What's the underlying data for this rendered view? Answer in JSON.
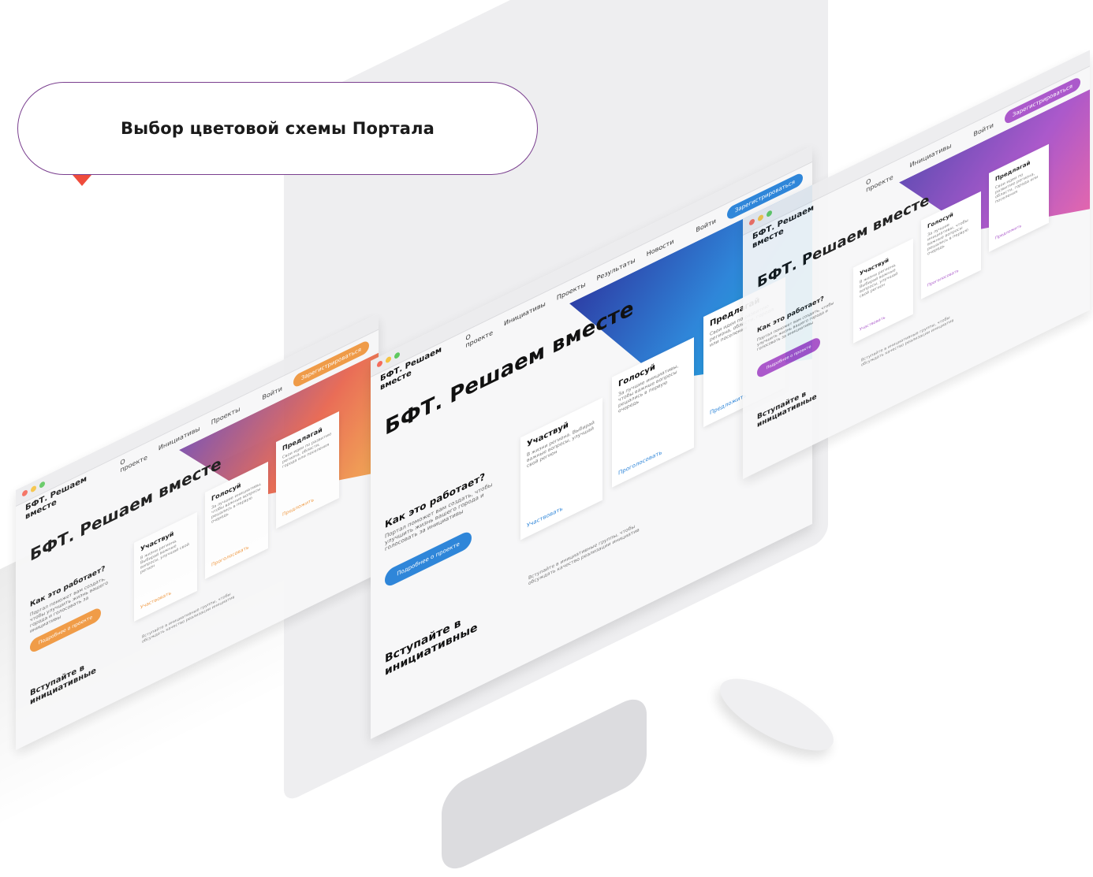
{
  "bubble": {
    "title": "Выбор цветовой схемы Портала"
  },
  "colors": {
    "bubble_border": "#7a3f8f",
    "bubble_tail": "#ef4c3c",
    "orange": "#f0953a",
    "blue": "#2f86d9",
    "purple": "#a44bc7"
  },
  "portal": {
    "logo": "БФТ. Решаем вместе",
    "nav": [
      "О проекте",
      "Инициативы",
      "Проекты",
      "Результаты",
      "Новости"
    ],
    "login": "Войти",
    "register": "Зарегистрироваться",
    "headline": "БФТ. Решаем вместе",
    "how_title": "Как это работает?",
    "how_text": "Портал поможет вам создать, чтобы улучшить жизнь вашего города и голосовать за инициативы",
    "more_button": "Подробнее о проекте",
    "cards": [
      {
        "title": "Участвуй",
        "desc": "В жизни региона. Выбирай важные вопросы, улучшай свой регион",
        "link": "Участвовать"
      },
      {
        "title": "Голосуй",
        "desc": "За лучшие инициативы, чтобы важные вопросы решались в первую очередь",
        "link": "Проголосовать"
      },
      {
        "title": "Предлагай",
        "desc": "Свои идеи по развитию региона, области, города или поселения",
        "link": "Предложить"
      }
    ],
    "join_title": "Вступайте в инициативные",
    "join_text": "Вступайте в инициативные группы, чтобы обсуждать качество реализации инициатив"
  }
}
